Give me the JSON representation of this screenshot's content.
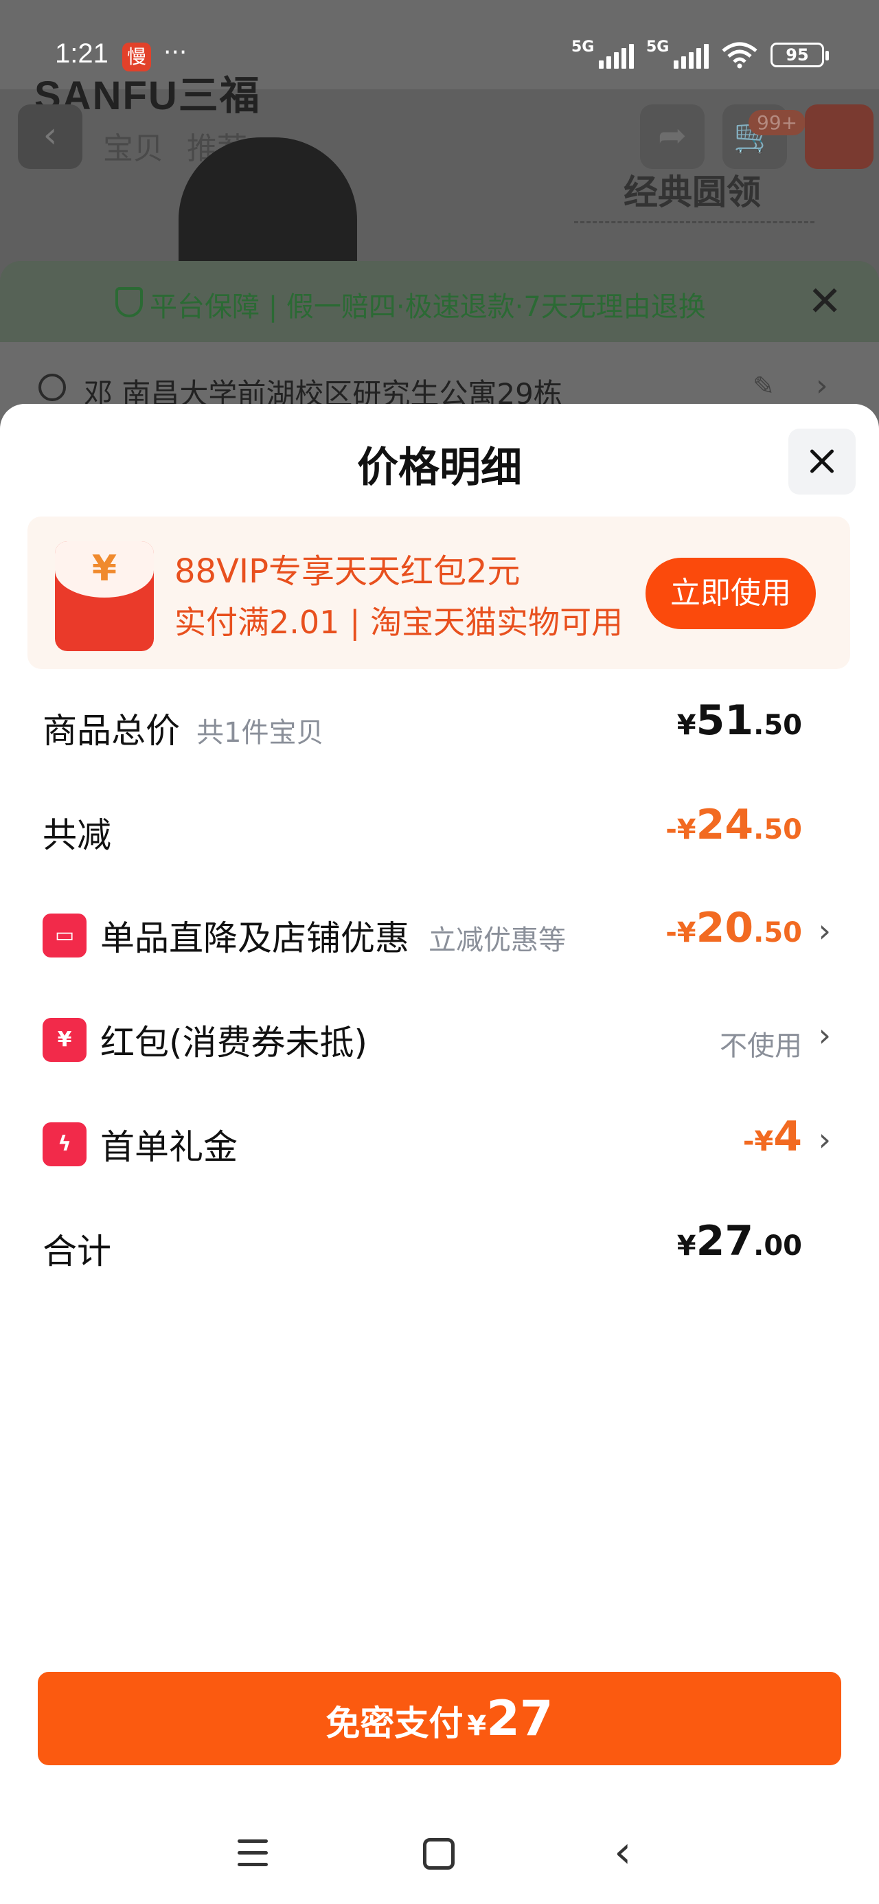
{
  "status_bar": {
    "time": "1:21",
    "app_icon_char": "慢",
    "more": "···",
    "signal1_label": "5G",
    "signal2_label": "5G",
    "battery": "95"
  },
  "background": {
    "logo": "SANFU三福",
    "tabs": [
      "宝贝",
      "推荐"
    ],
    "cart_badge": "99+",
    "product_title": "经典圆领",
    "guarantee": "平台保障 | 假一赔四·极速退款·7天无理由退换",
    "address": "邓 南昌大学前湖校区研究生公寓29栋"
  },
  "sheet": {
    "title": "价格明细"
  },
  "promo": {
    "icon_char": "¥",
    "title": "88VIP专享天天红包2元",
    "subtitle": "实付满2.01 | 淘宝天猫实物可用",
    "button": "立即使用"
  },
  "rows": {
    "total": {
      "label": "商品总价",
      "sub": "共1件宝贝",
      "currency": "¥",
      "int": "51",
      "dec": ".50"
    },
    "discount": {
      "label": "共减",
      "currency": "-¥",
      "int": "24",
      "dec": ".50"
    },
    "store": {
      "icon": "▭",
      "label": "单品直降及店铺优惠",
      "sub": "立减优惠等",
      "currency": "-¥",
      "int": "20",
      "dec": ".50"
    },
    "redpacket": {
      "icon": "¥",
      "label": "红包(消费券未抵)",
      "value": "不使用"
    },
    "firstorder": {
      "icon": "ϟ",
      "label": "首单礼金",
      "currency": "-¥",
      "int": "4",
      "dec": ""
    },
    "sum": {
      "label": "合计",
      "currency": "¥",
      "int": "27",
      "dec": ".00"
    }
  },
  "pay_button": {
    "label": "免密支付",
    "currency": "¥",
    "amount": "27"
  },
  "colors": {
    "accent": "#fb5a10",
    "price_orange": "#f26a21",
    "promo_text": "#e8501e",
    "icon_red": "#f22a4a"
  }
}
